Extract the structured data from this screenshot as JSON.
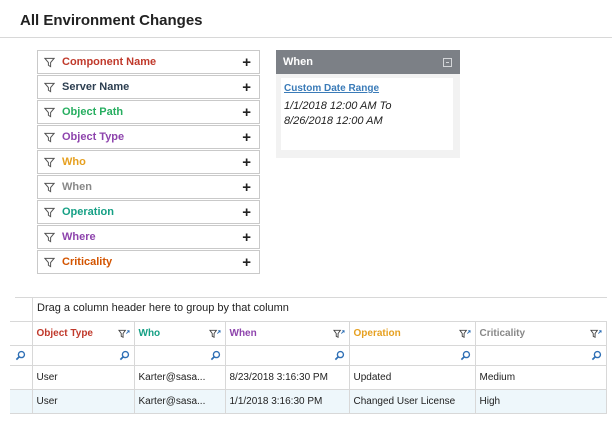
{
  "page": {
    "title": "All Environment Changes"
  },
  "filters": [
    {
      "label": "Component Name",
      "color": "#c0392b"
    },
    {
      "label": "Server Name",
      "color": "#2c3e50"
    },
    {
      "label": "Object Path",
      "color": "#27ae60"
    },
    {
      "label": "Object Type",
      "color": "#8e44ad"
    },
    {
      "label": "Who",
      "color": "#e6a020"
    },
    {
      "label": "When",
      "color": "#888888"
    },
    {
      "label": "Operation",
      "color": "#16a085"
    },
    {
      "label": "Where",
      "color": "#8e44ad"
    },
    {
      "label": "Criticality",
      "color": "#d35400"
    }
  ],
  "when_panel": {
    "title": "When",
    "link": "Custom Date Range",
    "range_line1": "1/1/2018 12:00 AM To",
    "range_line2": "8/26/2018 12:00 AM"
  },
  "grid": {
    "group_hint": "Drag a column header here to group by that column",
    "columns": [
      {
        "label": "Object Type",
        "color": "#c0392b"
      },
      {
        "label": "Who",
        "color": "#16a085"
      },
      {
        "label": "When",
        "color": "#8e44ad"
      },
      {
        "label": "Operation",
        "color": "#e6a020"
      },
      {
        "label": "Criticality",
        "color": "#888888"
      }
    ],
    "rows": [
      [
        "User",
        "Karter@sasa...",
        "8/23/2018 3:16:30 PM",
        "Updated",
        "Medium"
      ],
      [
        "User",
        "Karter@sasa...",
        "1/1/2018 3:16:30 PM",
        "Changed User License",
        "High"
      ]
    ]
  },
  "colors": {
    "accent_link": "#3a7bb8",
    "search_icon": "#2e6fb5",
    "panel_header": "#7c8086"
  }
}
